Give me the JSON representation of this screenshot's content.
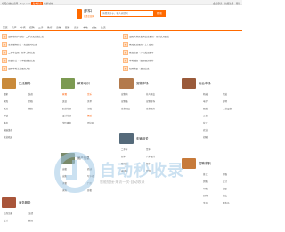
{
  "topbar": {
    "left_text": "昭阳分类信息网 - bojo.com",
    "left_pill": "发布信息",
    "left_extra": "切换城市",
    "right_text": "会员登录 · 免费注册 · 帮助"
  },
  "header": {
    "logo_text": "邵阳",
    "logo_sub": "分类信息网",
    "search_placeholder": "请搜索房子，输入关键词",
    "search_button": "搜索"
  },
  "nav": {
    "items": [
      "首页",
      "房产",
      "车辆",
      "招聘",
      "二手",
      "教育",
      "宠物",
      "服务",
      "商务",
      "本地",
      "交友",
      "生活"
    ]
  },
  "hot": {
    "rows": [
      {
        "tag": "热",
        "text": "邵阳市房产出租 · 二手买卖信息汇总",
        "tag2": "荐",
        "text2": "邵阳大祥区招聘信息更新 · 月薪过万职位"
      },
      {
        "tag": "新",
        "text": "宠物猫狗转让 · 免费发布信息",
        "tag2": "热",
        "text2": "家政保洁服务 · 上门维修"
      },
      {
        "tag": "荐",
        "text": "二手车交易 · 新车上市信息",
        "tag2": "新",
        "text2": "教育培训 · 少儿英语辅导"
      },
      {
        "tag": "热",
        "text": "商铺转让 · 写字楼出租信息",
        "tag2": "荐",
        "text2": "本地婚庆 · 摄影服务推荐"
      },
      {
        "tag": "新",
        "text": "邵阳本地生活服务大全",
        "tag2": "热",
        "text2": "招聘求职 · 兼职信息"
      }
    ]
  },
  "categories": [
    {
      "title": "生活服务",
      "color": "#c98a3a",
      "items": [
        "搬家",
        "家政",
        "保洁",
        "开锁",
        "维修",
        "电脑维修",
        "管道疏通",
        "装修",
        "回收",
        "婚庆"
      ]
    },
    {
      "title": "教育培训",
      "color": "#7c9a52",
      "items": [
        "家教",
        "英语",
        "职业培训",
        "设计培训",
        "学历教育",
        "音乐",
        "美术",
        "驾校",
        "舞蹈",
        "IT培训"
      ]
    },
    {
      "title": "宠物市场",
      "color": "#b37a4c",
      "items": [
        "宠物狗",
        "宠物猫",
        "宠物用品",
        "花鸟鱼虫",
        "宠物寄养",
        "宠物服务"
      ]
    },
    {
      "title": "行业市场",
      "color": "#9a5a3a",
      "items": [
        "机械",
        "电子",
        "服装",
        "五金",
        "化工",
        "农业",
        "印刷",
        "包装",
        "建材",
        "工业设备"
      ]
    },
    {
      "title": "车辆相关",
      "color": "#556a7a",
      "items": [
        "二手车",
        "新车",
        "摩托车",
        "电动车",
        "货车",
        "汽车配件",
        "租车",
        "代驾"
      ]
    },
    {
      "title": "商务服务",
      "color": "#a9553a",
      "items": [
        "工商注册",
        "会计",
        "法律",
        "翻译",
        "广告",
        "印刷",
        "网站建设",
        "物流"
      ]
    },
    {
      "title": "房产信息",
      "color": "#7a8a6a",
      "items": [
        "出租",
        "出售",
        "求租",
        "求购",
        "商铺",
        "写字楼",
        "厂房",
        "日租"
      ]
    },
    {
      "title": "招聘求职",
      "color": "#c77a3a",
      "items": [
        "普工",
        "销售",
        "司机",
        "厨师",
        "文员",
        "客服",
        "会计",
        "兼职",
        "保安",
        "服务员"
      ]
    }
  ],
  "watermark": {
    "text": "自动秒收录",
    "sub": "智能链接·来访一次·自动收录"
  },
  "colors": {
    "accent": "#ff6a00",
    "highlight": "#ff5a00"
  }
}
